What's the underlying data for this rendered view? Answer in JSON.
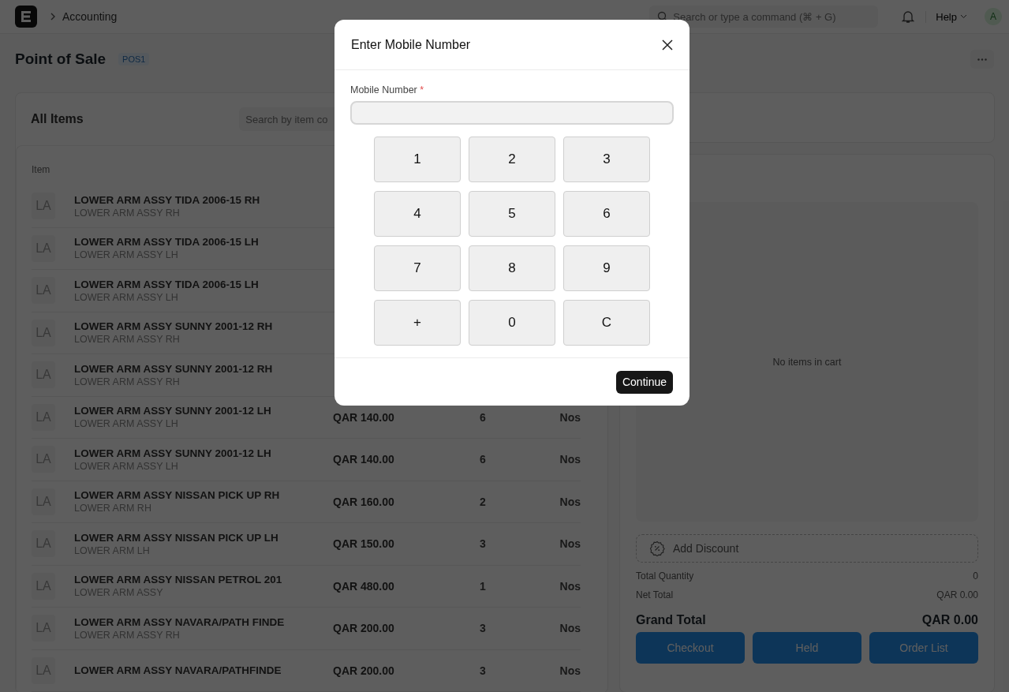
{
  "topbar": {
    "breadcrumb": "Accounting",
    "search": {
      "placeholder": "Search or type a command (⌘ + G)"
    },
    "help": "Help",
    "avatar": "A"
  },
  "page": {
    "title": "Point of Sale",
    "badge": "POS1"
  },
  "items_panel": {
    "title": "All Items",
    "search": {
      "placeholder": "Search by item co"
    },
    "columns": [
      "Item"
    ],
    "rows": [
      {
        "avatar": "LA",
        "name": "LOWER ARM ASSY TIDA 2006-15 RH",
        "subtitle": "LOWER ARM ASSY RH"
      },
      {
        "avatar": "LA",
        "name": "LOWER ARM ASSY TIDA 2006-15 LH",
        "subtitle": "LOWER ARM ASSY LH"
      },
      {
        "avatar": "LA",
        "name": "LOWER ARM ASSY TIDA 2006-15 LH",
        "subtitle": "LOWER ARM ASSY LH"
      },
      {
        "avatar": "LA",
        "name": "LOWER ARM ASSY SUNNY 2001-12 RH",
        "subtitle": "LOWER ARM ASSY RH"
      },
      {
        "avatar": "LA",
        "name": "LOWER ARM ASSY SUNNY 2001-12 RH",
        "subtitle": "LOWER ARM ASSY RH"
      },
      {
        "avatar": "LA",
        "name": "LOWER ARM ASSY SUNNY 2001-12 LH",
        "subtitle": "LOWER ARM ASSY LH",
        "price": "QAR 140.00",
        "qty": "6",
        "uom": "Nos"
      },
      {
        "avatar": "LA",
        "name": "LOWER ARM ASSY SUNNY 2001-12 LH",
        "subtitle": "LOWER ARM ASSY LH",
        "price": "QAR 140.00",
        "qty": "6",
        "uom": "Nos"
      },
      {
        "avatar": "LA",
        "name": "LOWER ARM ASSY NISSAN PICK UP RH",
        "subtitle": "LOWER ARM RH",
        "price": "QAR 160.00",
        "qty": "2",
        "uom": "Nos"
      },
      {
        "avatar": "LA",
        "name": "LOWER ARM ASSY NISSAN PICK UP LH",
        "subtitle": "LOWER ARM LH",
        "price": "QAR 150.00",
        "qty": "3",
        "uom": "Nos"
      },
      {
        "avatar": "LA",
        "name": "LOWER ARM ASSY NISSAN PETROL 201",
        "subtitle": "LOWER ARM ASSY",
        "price": "QAR 480.00",
        "qty": "1",
        "uom": "Nos"
      },
      {
        "avatar": "LA",
        "name": "LOWER ARM ASSY NAVARA/PATH FINDE",
        "subtitle": "LOWER ARM ASSY RH",
        "price": "QAR 200.00",
        "qty": "3",
        "uom": "Nos"
      },
      {
        "avatar": "LA",
        "name": "LOWER ARM ASSY NAVARA/PATHFINDE",
        "price": "QAR 200.00",
        "qty": "3",
        "uom": "Nos"
      }
    ]
  },
  "cart": {
    "empty_text": "No items in cart",
    "discount": "Add Discount",
    "totals": [
      {
        "label": "Total Quantity",
        "value": "0"
      },
      {
        "label": "Net Total",
        "value": "QAR 0.00"
      }
    ],
    "grand_total": {
      "label": "Grand Total",
      "value": "QAR 0.00"
    },
    "actions": [
      "Checkout",
      "Held",
      "Order List"
    ]
  },
  "modal": {
    "title": "Enter Mobile Number",
    "field": {
      "label": "Mobile Number",
      "required_mark": "*"
    },
    "keys": [
      "1",
      "2",
      "3",
      "4",
      "5",
      "6",
      "7",
      "8",
      "9",
      "+",
      "0",
      "C"
    ],
    "primary": "Continue"
  }
}
